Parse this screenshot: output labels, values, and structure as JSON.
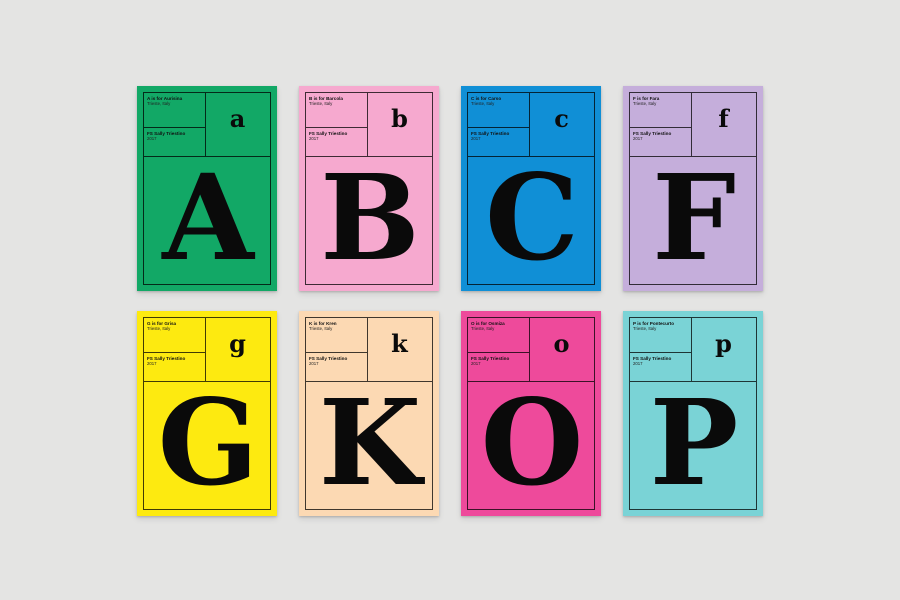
{
  "cards": [
    {
      "caption": "A is for Aurisina",
      "place": "Trieste, Italy",
      "font": "FS Sally Triestino",
      "year": "2017",
      "small": "a",
      "big": "A",
      "color": "#12a866"
    },
    {
      "caption": "B is for Barcola",
      "place": "Trieste, Italy",
      "font": "FS Sally Triestino",
      "year": "2017",
      "small": "b",
      "big": "B",
      "color": "#f6a9cf"
    },
    {
      "caption": "C is for Carso",
      "place": "Trieste, Italy",
      "font": "FS Sally Triestino",
      "year": "2017",
      "small": "c",
      "big": "C",
      "color": "#108fd6"
    },
    {
      "caption": "F is for Fara",
      "place": "Trieste, Italy",
      "font": "FS Sally Triestino",
      "year": "2017",
      "small": "f",
      "big": "F",
      "color": "#c5aedb"
    },
    {
      "caption": "G is for Grisa",
      "place": "Trieste, Italy",
      "font": "FS Sally Triestino",
      "year": "2017",
      "small": "g",
      "big": "G",
      "color": "#fdea10"
    },
    {
      "caption": "K is for Kren",
      "place": "Trieste, Italy",
      "font": "FS Sally Triestino",
      "year": "2017",
      "small": "k",
      "big": "K",
      "color": "#fcd9b3"
    },
    {
      "caption": "O is for Osmiza",
      "place": "Trieste, Italy",
      "font": "FS Sally Triestino",
      "year": "2017",
      "small": "o",
      "big": "O",
      "color": "#ee4a9b"
    },
    {
      "caption": "P is for Pontecurto",
      "place": "Trieste, Italy",
      "font": "FS Sally Triestino",
      "year": "2017",
      "small": "p",
      "big": "P",
      "color": "#7ad3d6"
    }
  ]
}
